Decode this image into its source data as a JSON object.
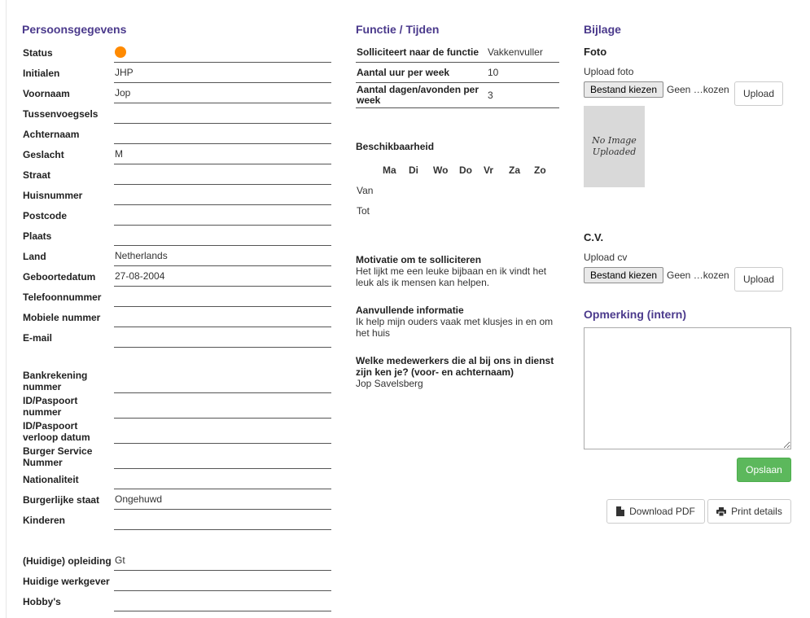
{
  "personal": {
    "title": "Persoonsgegevens",
    "rows": [
      {
        "label": "Status",
        "value": ""
      },
      {
        "label": "Initialen",
        "value": "JHP"
      },
      {
        "label": "Voornaam",
        "value": "Jop"
      },
      {
        "label": "Tussenvoegsels",
        "value": ""
      },
      {
        "label": "Achternaam",
        "value": ""
      },
      {
        "label": "Geslacht",
        "value": "M"
      },
      {
        "label": "Straat",
        "value": ""
      },
      {
        "label": "Huisnummer",
        "value": ""
      },
      {
        "label": "Postcode",
        "value": ""
      },
      {
        "label": "Plaats",
        "value": ""
      },
      {
        "label": "Land",
        "value": "Netherlands"
      },
      {
        "label": "Geboortedatum",
        "value": "27-08-2004"
      },
      {
        "label": "Telefoonnummer",
        "value": ""
      },
      {
        "label": "Mobiele nummer",
        "value": ""
      },
      {
        "label": "E-mail",
        "value": ""
      },
      {
        "label": "Bankrekening nummer",
        "value": ""
      },
      {
        "label": "ID/Paspoort nummer",
        "value": ""
      },
      {
        "label": "ID/Paspoort verloop datum",
        "value": ""
      },
      {
        "label": "Burger Service Nummer",
        "value": ""
      },
      {
        "label": "Nationaliteit",
        "value": ""
      },
      {
        "label": "Burgerlijke staat",
        "value": "Ongehuwd"
      },
      {
        "label": "Kinderen",
        "value": ""
      },
      {
        "label": "(Huidige) opleiding",
        "value": "Gt"
      },
      {
        "label": "Huidige werkgever",
        "value": ""
      },
      {
        "label": "Hobby's",
        "value": ""
      }
    ],
    "status_color": "#ff8a00"
  },
  "function": {
    "title": "Functie / Tijden",
    "rows": [
      {
        "label": "Solliciteert naar de functie",
        "value": "Vakkenvuller"
      },
      {
        "label": "Aantal uur per week",
        "value": "10"
      },
      {
        "label": "Aantal dagen/avonden per week",
        "value": "3"
      }
    ],
    "availability_title": "Beschikbaarheid",
    "days": [
      "Ma",
      "Di",
      "Wo",
      "Do",
      "Vr",
      "Za",
      "Zo"
    ],
    "from_label": "Van",
    "to_label": "Tot",
    "motivation_label": "Motivatie om te solliciteren",
    "motivation_text": "Het lijkt me een leuke bijbaan en ik vindt het leuk als ik mensen kan helpen.",
    "extra_label": "Aanvullende informatie",
    "extra_text": "Ik help mijn ouders vaak met klusjes in en om het huis",
    "colleagues_label": "Welke medewerkers die al bij ons in dienst zijn ken je? (voor- en achternaam)",
    "colleagues_text": "Jop Savelsberg"
  },
  "attachment": {
    "title": "Bijlage",
    "photo_title": "Foto",
    "photo_upload_label": "Upload foto",
    "choose_file": "Bestand kiezen",
    "no_file": "Geen …kozen",
    "upload_button": "Upload",
    "no_image_line1": "No Image",
    "no_image_line2": "Uploaded",
    "cv_title": "C.V.",
    "cv_upload_label": "Upload cv",
    "remark_title": "Opmerking (intern)",
    "save_button": "Opslaan",
    "download_pdf": "Download PDF",
    "print_details": "Print details"
  }
}
